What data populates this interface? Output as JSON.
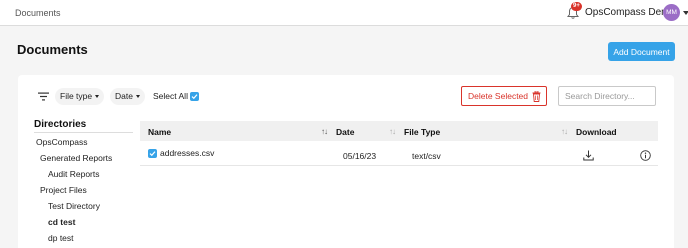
{
  "header": {
    "breadcrumb": "Documents",
    "notification_badge": "9+",
    "account_name": "OpsCompass Demo",
    "avatar_initials": "MM"
  },
  "page": {
    "title": "Documents",
    "add_button_label": "Add Document"
  },
  "toolbar": {
    "filter_icon": "filter-icon",
    "file_type_label": "File type",
    "date_label": "Date",
    "select_all_label": "Select All",
    "select_all_checked": true,
    "delete_selected_label": "Delete Selected",
    "search_placeholder": "Search Directory..."
  },
  "directories": {
    "title": "Directories",
    "items": [
      {
        "label": "OpsCompass",
        "level": 0,
        "bold": false
      },
      {
        "label": "Generated Reports",
        "level": 1,
        "bold": false
      },
      {
        "label": "Audit Reports",
        "level": 2,
        "bold": false
      },
      {
        "label": "Project Files",
        "level": 1,
        "bold": false
      },
      {
        "label": "Test Directory",
        "level": 2,
        "bold": false
      },
      {
        "label": "cd test",
        "level": 2,
        "bold": true
      },
      {
        "label": "dp test",
        "level": 2,
        "bold": false
      }
    ]
  },
  "table": {
    "columns": [
      "Name",
      "Date",
      "File Type",
      "Download"
    ],
    "rows": [
      {
        "name": "addresses.csv",
        "checked": true,
        "date": "05/16/23",
        "file_type": "text/csv"
      }
    ]
  },
  "colors": {
    "accent": "#36a3e8",
    "danger": "#d9342b",
    "avatar": "#9b6dc6"
  }
}
